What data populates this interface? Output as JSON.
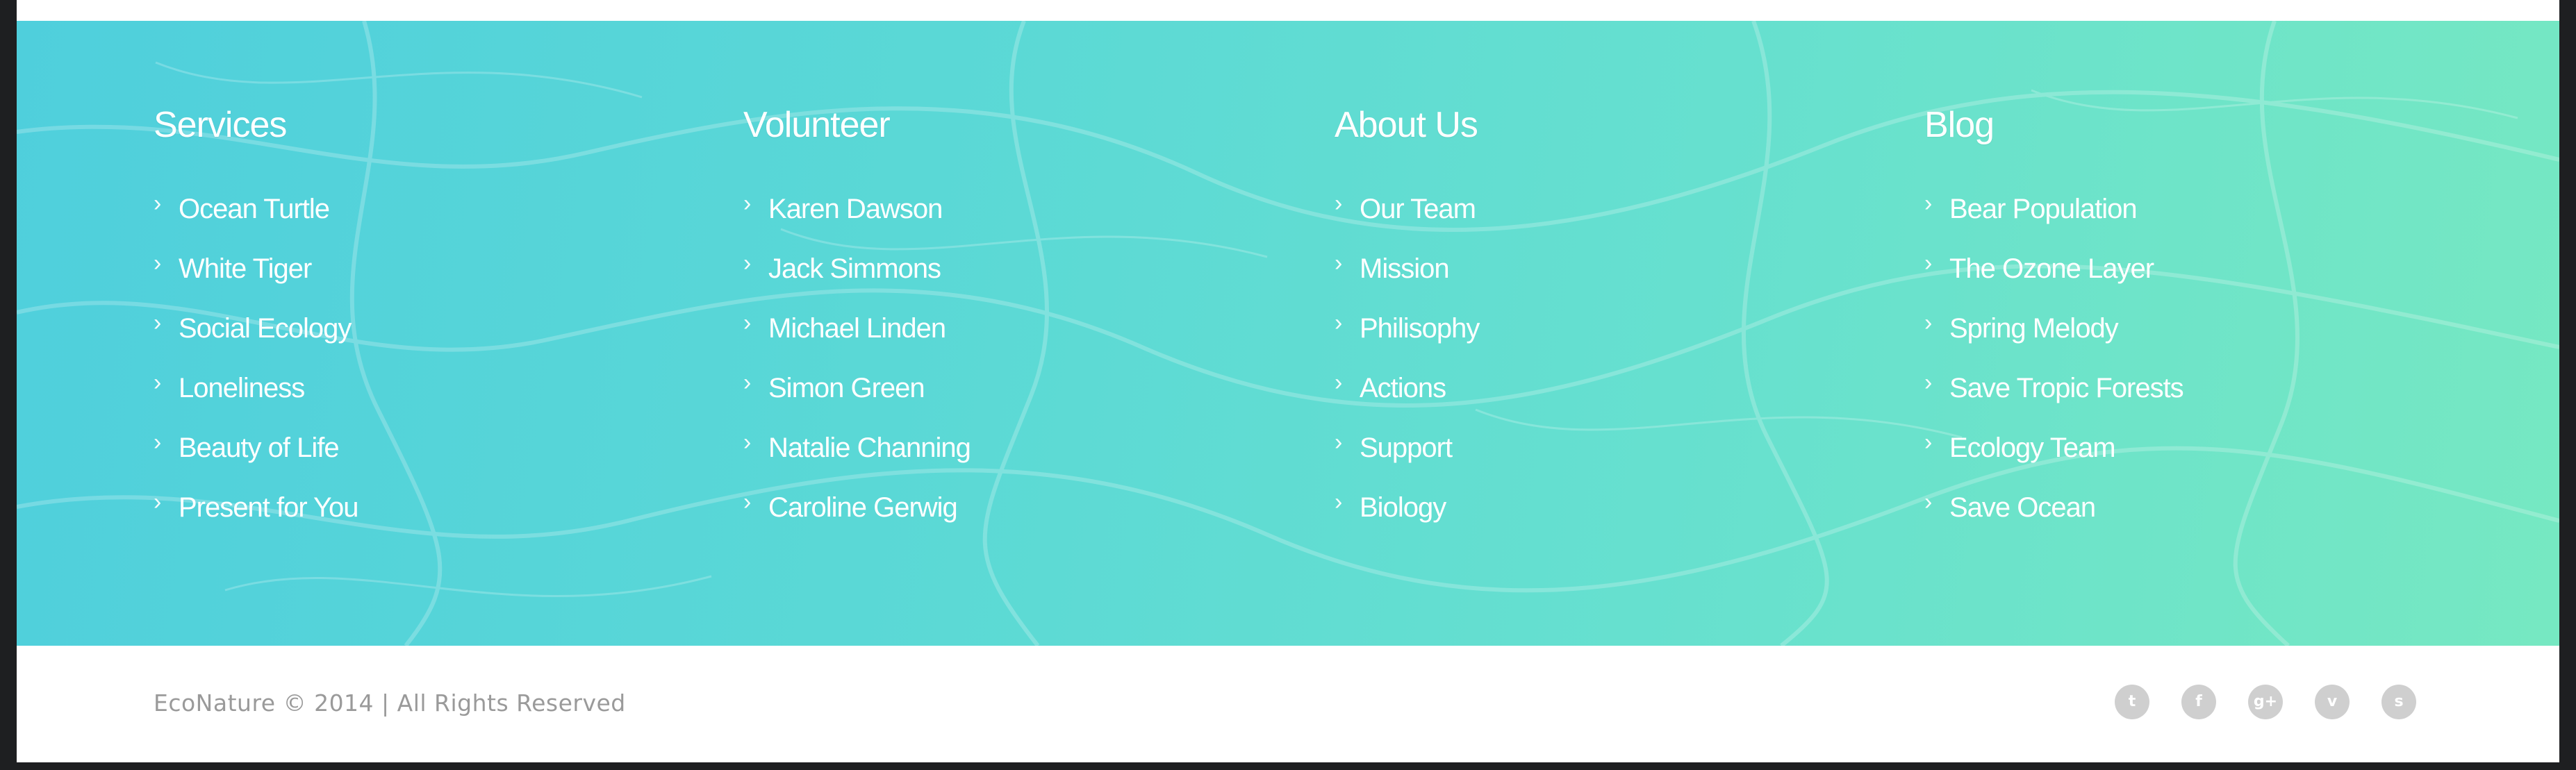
{
  "footer": {
    "columns": [
      {
        "title": "Services",
        "links": [
          "Ocean Turtle",
          "White Tiger",
          "Social Ecology",
          "Loneliness",
          "Beauty of Life",
          "Present for You"
        ]
      },
      {
        "title": "Volunteer",
        "links": [
          "Karen Dawson",
          "Jack Simmons",
          "Michael Linden",
          "Simon Green",
          "Natalie Channing",
          "Caroline Gerwig"
        ]
      },
      {
        "title": "About Us",
        "links": [
          "Our Team",
          "Mission",
          "Philisophy",
          "Actions",
          "Support",
          "Biology"
        ]
      },
      {
        "title": "Blog",
        "links": [
          "Bear Population",
          "The Ozone Layer",
          "Spring Melody",
          "Save Tropic Forests",
          "Ecology Team",
          "Save Ocean"
        ]
      }
    ],
    "chevron": "›",
    "copyright": "EcoNature © 2014 | All Rights Reserved",
    "social": [
      {
        "icon": "twitter-icon",
        "glyph": "t"
      },
      {
        "icon": "facebook-icon",
        "glyph": "f"
      },
      {
        "icon": "google-plus-icon",
        "glyph": "g+"
      },
      {
        "icon": "vimeo-icon",
        "glyph": "v"
      },
      {
        "icon": "skype-icon",
        "glyph": "s"
      }
    ],
    "colors": {
      "gradient_start": "#4fcfdc",
      "gradient_end": "#76e8c2",
      "copyright_text": "#9a9a9a",
      "social_icon_bg": "#cfcfcf"
    }
  }
}
